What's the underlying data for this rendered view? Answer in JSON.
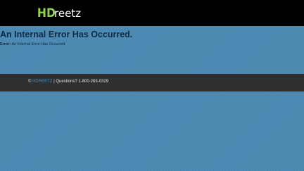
{
  "header": {
    "logo_text": "HDreetz",
    "logo_colors": {
      "primary": "#8ed14a",
      "shadow": "#3f6b1f"
    }
  },
  "error": {
    "title": "An Internal Error Has Occurred.",
    "label": "Error:",
    "message": "An Internal Error Has Occurred."
  },
  "footer": {
    "copyright": "©",
    "brand_link": "HDREETZ",
    "contact": "| Questions? 1-800-283-0329"
  },
  "colors": {
    "page_background": "#4a87b0",
    "header_background": "#000000",
    "footer_background": "#2e2f31",
    "link": "#3d8fd0",
    "error_text": "#0d2a45"
  }
}
